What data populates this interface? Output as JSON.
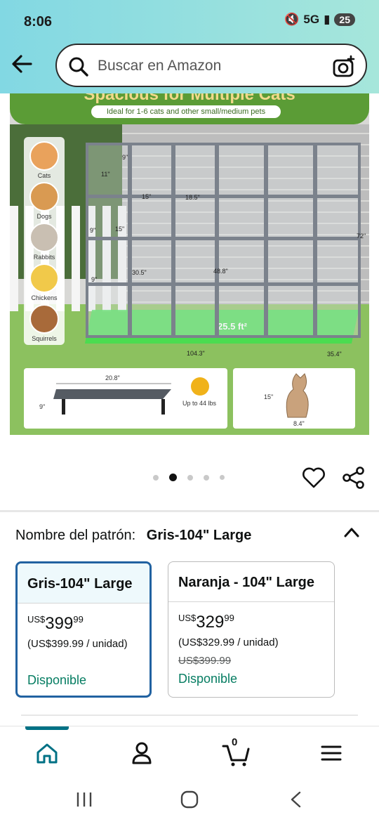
{
  "status_bar": {
    "time": "8:06",
    "network": "5G",
    "battery": "25"
  },
  "search": {
    "placeholder": "Buscar en Amazon"
  },
  "product_image": {
    "banner_title": "Spacious for Multiple Cats",
    "banner_subtitle": "Ideal for 1-6 cats and other small/medium pets",
    "animals": [
      "Cats",
      "Dogs",
      "Rabbits",
      "Chickens",
      "Squirrels"
    ],
    "floor_area": "25.5 ft²",
    "dims": {
      "a": "9\"",
      "b": "11\"",
      "c": "15\"",
      "d": "18.5\"",
      "e": "9\"",
      "f": "15\"",
      "g": "30.5\"",
      "h": "9\"",
      "i": "48.8\"",
      "height": "72\"",
      "width": "104.3\"",
      "depth": "35.4\""
    },
    "shelf_card": {
      "length": "20.8\"",
      "height": "9\"",
      "load": "Up to 44 lbs"
    },
    "scratcher_card": {
      "height": "15\"",
      "width": "8.4\""
    }
  },
  "carousel": {
    "total": 5,
    "active_index": 1
  },
  "pattern": {
    "label": "Nombre del patrón:",
    "value": "Gris-104\" Large"
  },
  "options": [
    {
      "title": "Gris-104\" Large",
      "currency": "US$",
      "price_whole": "399",
      "price_cents": "99",
      "unit_price": "(US$399.99 / unidad)",
      "list_price": "",
      "availability": "Disponible",
      "selected": true
    },
    {
      "title": "Naranja - 104\" Large",
      "currency": "US$",
      "price_whole": "329",
      "price_cents": "99",
      "unit_price": "(US$329.99 / unidad)",
      "list_price": "US$399.99",
      "availability": "Disponible",
      "selected": false
    }
  ],
  "bottom_nav": {
    "cart_count": "0"
  },
  "colors": {
    "accent": "#007185",
    "selected_border": "#2162a1",
    "available": "#067d62",
    "header_start": "#82d8e3",
    "header_end": "#a6e6db"
  },
  "icons": [
    "back-arrow-icon",
    "search-icon",
    "camera-icon",
    "heart-icon",
    "share-icon",
    "chevron-up-icon",
    "home-icon",
    "account-icon",
    "cart-icon",
    "menu-icon"
  ]
}
